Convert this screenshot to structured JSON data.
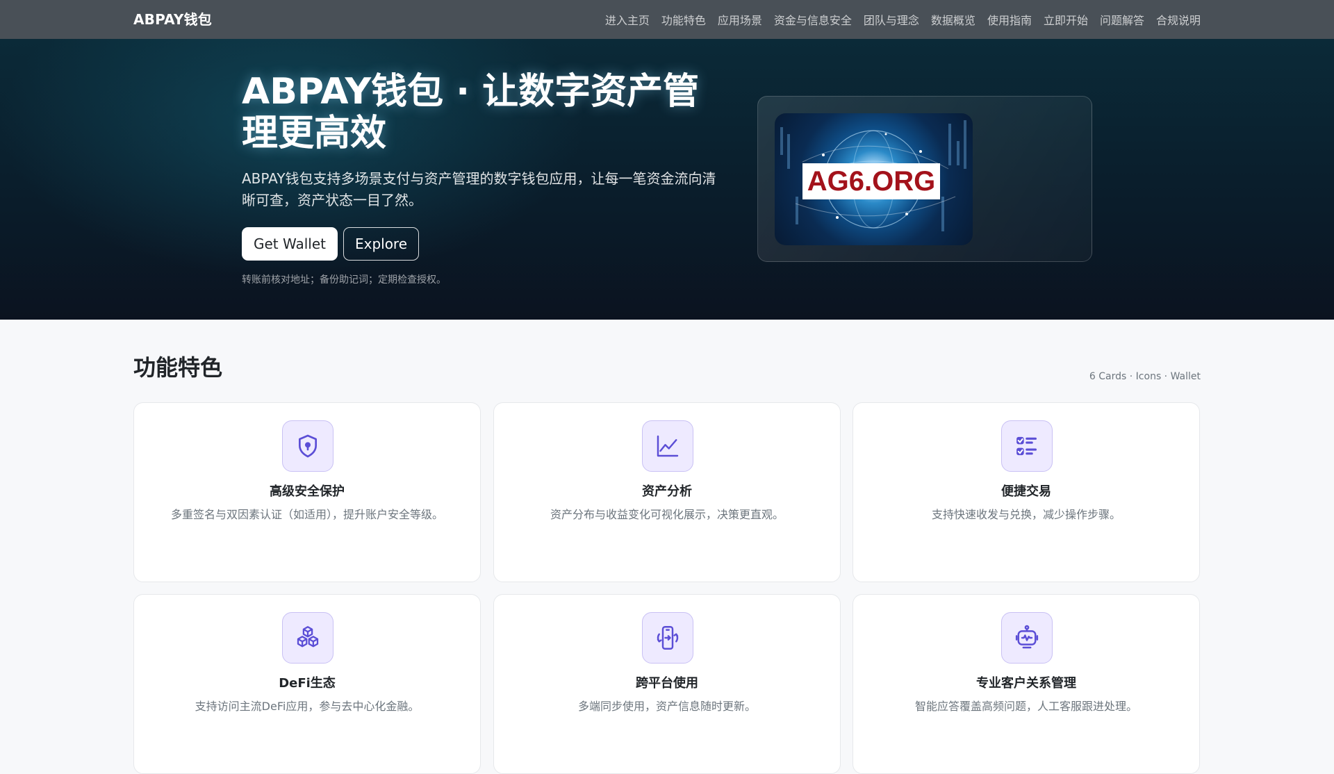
{
  "navbar": {
    "brand": "ABPAY钱包",
    "links": [
      "进入主页",
      "功能特色",
      "应用场景",
      "资金与信息安全",
      "团队与理念",
      "数据概览",
      "使用指南",
      "立即开始",
      "问题解答",
      "合规说明"
    ]
  },
  "hero": {
    "title": "ABPAY钱包 · 让数字资产管理更高效",
    "subtitle": "ABPAY钱包支持多场景支付与资产管理的数字钱包应用，让每一笔资金流向清晰可查，资产状态一目了然。",
    "primary_button": "Get Wallet",
    "secondary_button": "Explore",
    "note": "转账前核对地址；备份助记词；定期检查授权。",
    "image_label": "AG6.ORG"
  },
  "features": {
    "title": "功能特色",
    "meta": "6 Cards · Icons · Wallet",
    "cards": [
      {
        "title": "高级安全保护",
        "desc": "多重签名与双因素认证（如适用），提升账户安全等级。",
        "icon": "shield-lock-icon"
      },
      {
        "title": "资产分析",
        "desc": "资产分布与收益变化可视化展示，决策更直观。",
        "icon": "line-chart-icon"
      },
      {
        "title": "便捷交易",
        "desc": "支持快速收发与兑换，减少操作步骤。",
        "icon": "checklist-icon"
      },
      {
        "title": "DeFi生态",
        "desc": "支持访问主流DeFi应用，参与去中心化金融。",
        "icon": "cubes-icon"
      },
      {
        "title": "跨平台使用",
        "desc": "多端同步使用，资产信息随时更新。",
        "icon": "phone-sync-icon"
      },
      {
        "title": "专业客户关系管理",
        "desc": "智能应答覆盖高频问题，人工客服跟进处理。",
        "icon": "robot-icon"
      }
    ]
  },
  "colors": {
    "navbar": "#495057",
    "accent_icon": "#5b4ed6",
    "icon_bg": "#eeeaff"
  }
}
